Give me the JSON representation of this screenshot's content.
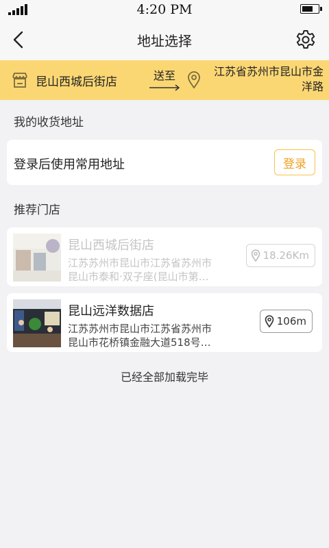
{
  "status": {
    "time": "4:20 PM",
    "battery": 0.6
  },
  "nav": {
    "title": "地址选择",
    "icons": [
      "back-chevron",
      "gear"
    ]
  },
  "deliver": {
    "store": "昆山西城后街店",
    "send_label": "送至",
    "address_line1": "江苏省苏州市昆山市金",
    "address_line2": "洋路",
    "color": "#fbd774"
  },
  "my_address": {
    "section_title": "我的收货地址",
    "prompt": "登录后使用常用地址",
    "login_label": "登录"
  },
  "recommend": {
    "section_title": "推荐门店",
    "stores": [
      {
        "name": "昆山西城后街店",
        "address_line1": "江苏苏州市昆山市江苏省苏州市",
        "address_line2": "昆山市泰和·双子座(昆山市第…",
        "distance": "18.26Km"
      },
      {
        "name": "昆山远洋数据店",
        "address_line1": "江苏苏州市昆山市江苏省苏州市",
        "address_line2": "昆山市花桥镇金融大道518号…",
        "distance": "106m"
      }
    ]
  },
  "footer": "已经全部加载完毕",
  "accent": "#f0a020"
}
